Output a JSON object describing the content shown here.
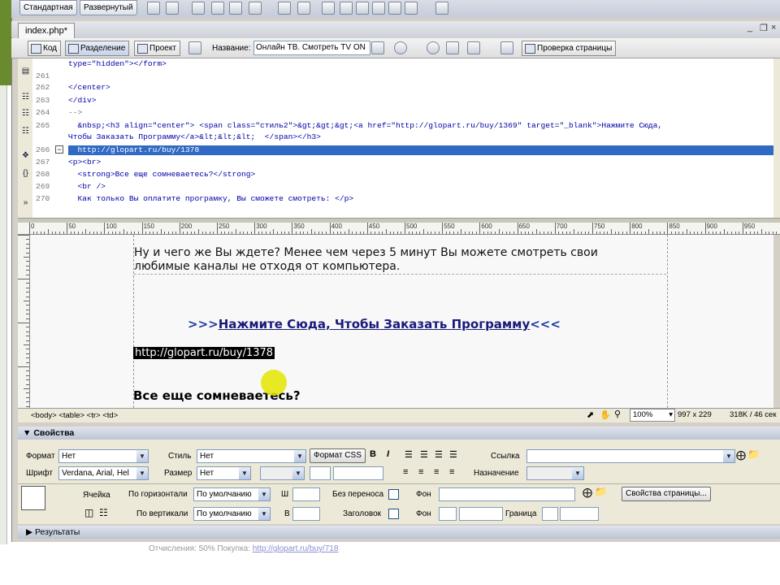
{
  "top_tabs": {
    "standard": "Стандартная",
    "expanded": "Развернутый"
  },
  "document": {
    "tab_name": "index.php*",
    "window_controls": [
      "_",
      "❐",
      "×"
    ]
  },
  "doc_toolbar": {
    "code": "Код",
    "split": "Разделение",
    "design": "Проект",
    "title_label": "Название:",
    "title_value": "Онлайн ТВ.  Смотреть TV ON",
    "check_page": "Проверка страницы"
  },
  "code_lines": [
    {
      "n": "",
      "text": "type=\"hidden\"></form>"
    },
    {
      "n": "261",
      "text": ""
    },
    {
      "n": "262",
      "text": "</center>"
    },
    {
      "n": "263",
      "text": "</div>"
    },
    {
      "n": "264",
      "text": "-->"
    },
    {
      "n": "265",
      "text": "  &nbsp;<h3 align=\"center\"> <span class=\"стиль2\">&gt;&gt;&gt;<a href=\"http://glopart.ru/buy/1369\" target=\"_blank\">Нажмите Сюда,"
    },
    {
      "n": "",
      "text": "Чтобы Заказать Программу</a>&lt;&lt;&lt;  </span></h3>"
    },
    {
      "n": "266",
      "text": "  http://glopart.ru/buy/1378"
    },
    {
      "n": "267",
      "text": "<p><br>"
    },
    {
      "n": "268",
      "text": "  <strong>Все еще сомневаетесь?</strong>"
    },
    {
      "n": "269",
      "text": "  <br />"
    },
    {
      "n": "270",
      "text": "  Как только Вы оплатите програмку, Вы сможете смотреть: </p>"
    }
  ],
  "ruler_labels": [
    "0",
    "50",
    "100",
    "150",
    "200",
    "250",
    "300",
    "350",
    "400",
    "450",
    "500",
    "550",
    "600",
    "650",
    "700",
    "750",
    "800",
    "850",
    "900",
    "950"
  ],
  "design": {
    "line1": "Ну и чего же Вы ждете? Менее чем через 5 минут Вы можете смотреть свои",
    "line2": "любимые каналы не отходя от компьютера.",
    "link_prefix": ">>>",
    "link_text": "Нажмите Сюда, Чтобы Заказать Программу",
    "link_suffix": "<<<",
    "selected_url": "http://glopart.ru/buy/1378",
    "heading": "Все еще сомневаетесь?"
  },
  "status": {
    "tag_path": "<body> <table> <tr> <td>",
    "zoom": "100%",
    "size": "997 x 229",
    "filesize": "318K / 46 сек"
  },
  "properties": {
    "title": "Свойства",
    "format_label": "Формат",
    "format_value": "Нет",
    "style_label": "Стиль",
    "style_value": "Нет",
    "format_css": "Формат CSS",
    "bold": "B",
    "italic": "I",
    "link_label": "Ссылка",
    "font_label": "Шрифт",
    "font_value": "Verdana, Arial, Hel",
    "size_label": "Размер",
    "size_value": "Нет",
    "target_label": "Назначение",
    "cell_label": "Ячейка",
    "horz_label": "По горизонтали",
    "horz_value": "По умолчанию",
    "w_label": "Ш",
    "nowrap_label": "Без переноса",
    "bg_label": "Фон",
    "page_props": "Свойства страницы...",
    "vert_label": "По вертикали",
    "vert_value": "По умолчанию",
    "h_label": "В",
    "header_label": "Заголовок",
    "bg2_label": "Фон",
    "border_label": "Граница"
  },
  "results": {
    "label": "Результаты"
  },
  "footer": {
    "text": "Отчисления: 50%   Покупка:",
    "link": "http://glopart.ru/buy/718"
  }
}
